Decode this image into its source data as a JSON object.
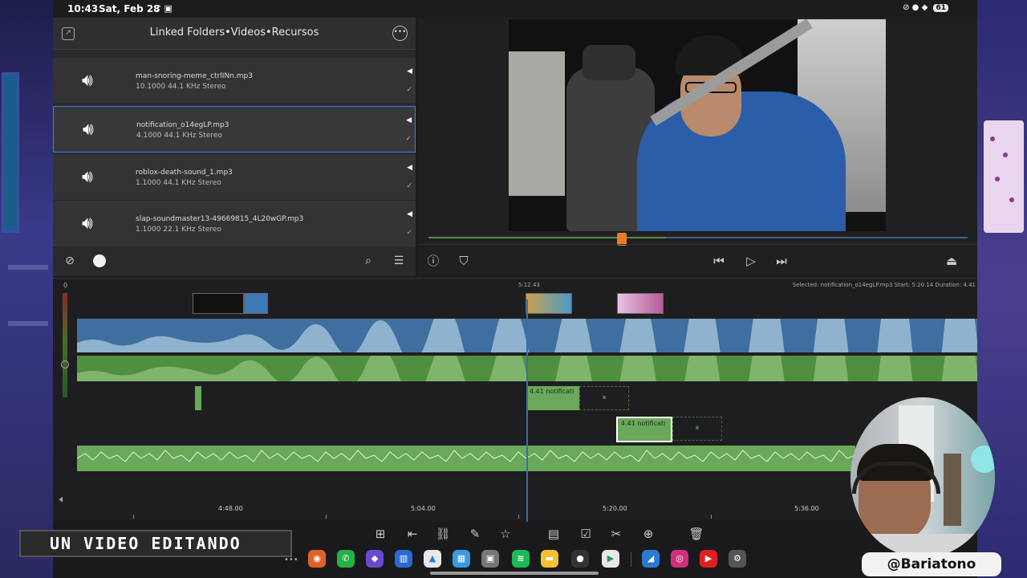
{
  "status": {
    "time": "10:43",
    "date": "Sat, Feb 28",
    "battery": "61"
  },
  "browser": {
    "title": "Linked Folders•Videos•Recursos",
    "files": [
      {
        "name": "man-snoring-meme_ctrlINn.mp3",
        "meta": "10.1000 44.1 KHz Stereo"
      },
      {
        "name": "notification_o14egLP.mp3",
        "meta": "4.1000 44.1 KHz Stereo"
      },
      {
        "name": "roblox-death-sound_1.mp3",
        "meta": "1.1000 44.1 KHz Stereo"
      },
      {
        "name": "slap-soundmaster13-49669815_4L20wGP.mp3",
        "meta": "1.1000 22.1 KHz Stereo"
      }
    ]
  },
  "timeline": {
    "zero": "0",
    "position": "5:12.43",
    "selected_info": "Selected: notification_o14egLP.mp3 Start: 5:20.14 Duration: 4.41",
    "clip_label_1": "4.41 notificati",
    "clip_label_2": "4.41 notificati",
    "ruler": [
      "4:48.00",
      "5:04.00",
      "5:20.00",
      "5:36.00"
    ]
  },
  "overlay": {
    "caption": "UN VIDEO EDITANDO",
    "handle": "@Bariatono"
  },
  "colors": {
    "accent_select": "#3a7cf0",
    "playhead": "#f07a2a",
    "video_track": "#3f6f9f",
    "audio_track": "#4f8f3f",
    "music_track": "#6aa85a"
  }
}
